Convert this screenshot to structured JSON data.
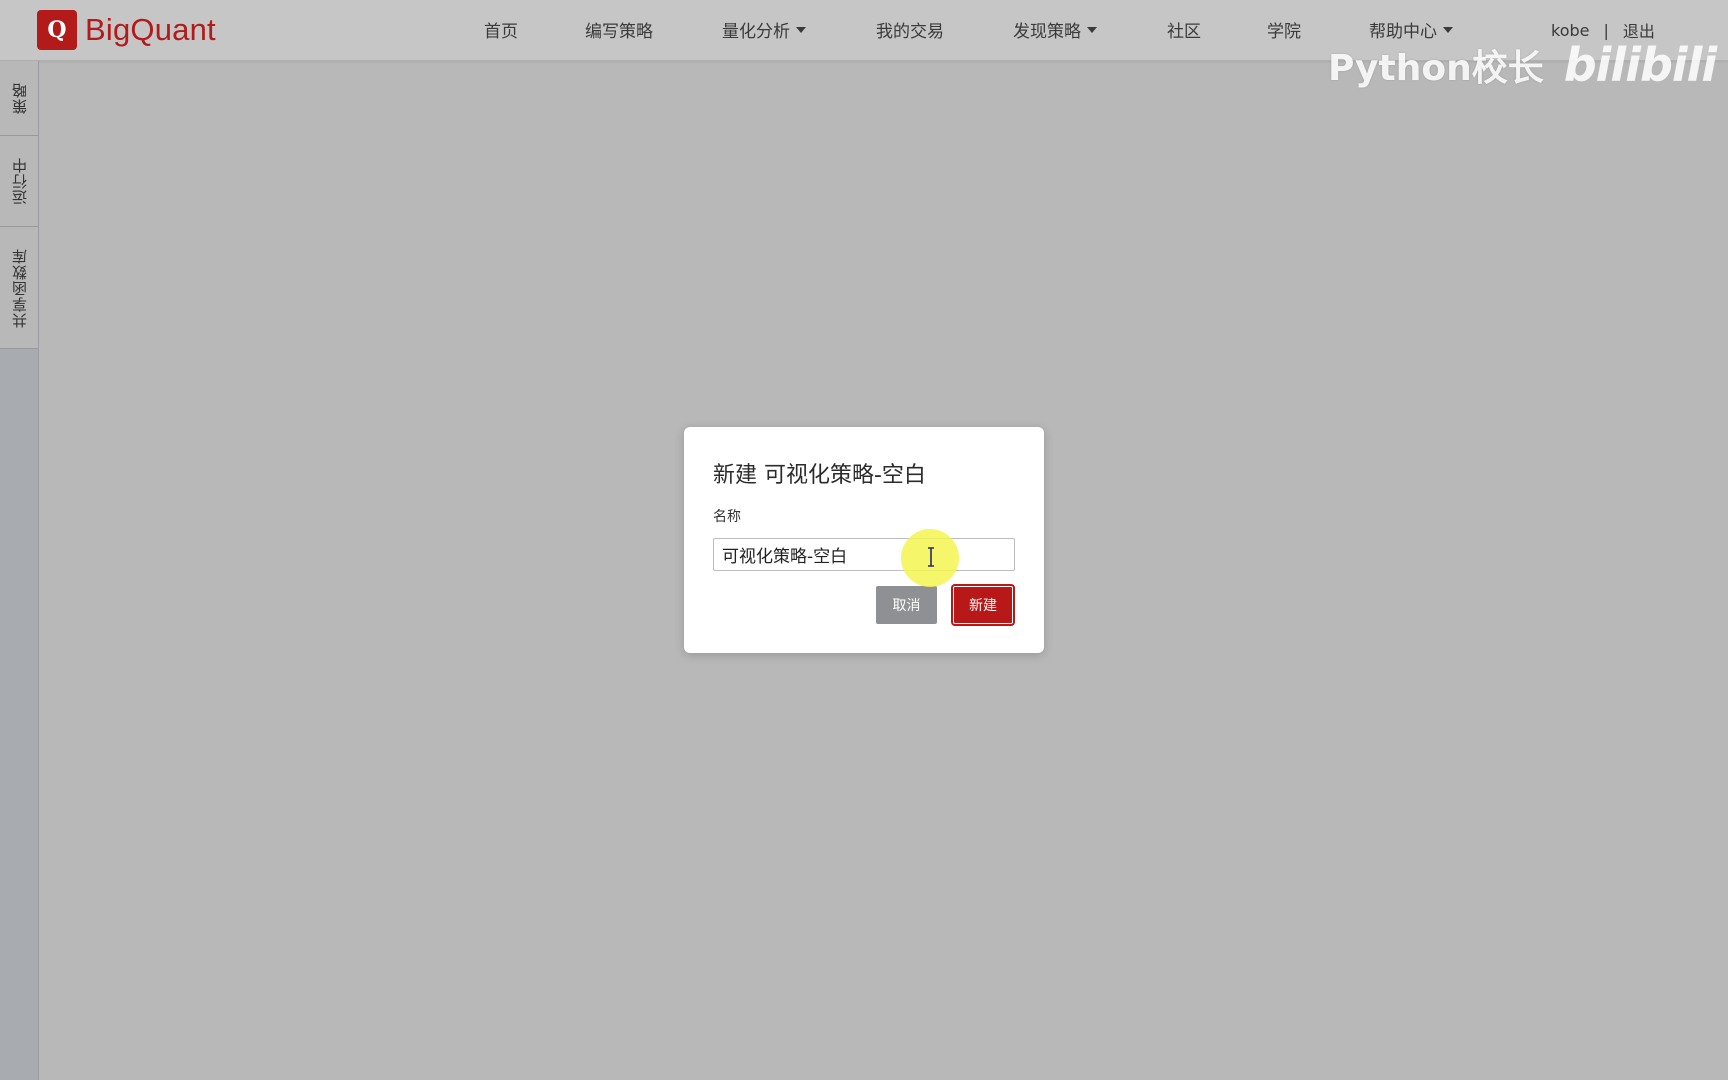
{
  "brand": {
    "logo_letter": "Q",
    "name": "BigQuant",
    "accent_color": "#b31a1a"
  },
  "nav": {
    "items": [
      {
        "label": "首页"
      },
      {
        "label": "编写策略"
      },
      {
        "label": "量化分析",
        "dropdown": true
      },
      {
        "label": "我的交易"
      },
      {
        "label": "发现策略",
        "dropdown": true
      },
      {
        "label": "社区"
      },
      {
        "label": "学院"
      },
      {
        "label": "帮助中心",
        "dropdown": true
      }
    ]
  },
  "user": {
    "name": "kobe",
    "separator": "|",
    "logout": "退出"
  },
  "watermark": {
    "text": "Python校长",
    "logo": "bilibili"
  },
  "sidebar": {
    "tabs": [
      {
        "label": "策略"
      },
      {
        "label": "运行中"
      },
      {
        "label": "共享函数库"
      }
    ]
  },
  "dialog": {
    "title": "新建 可视化策略-空白",
    "name_label": "名称",
    "name_value": "可视化策略-空白",
    "cancel_label": "取消",
    "create_label": "新建"
  },
  "icons": {
    "cursor": "text-cursor-icon",
    "caret": "chevron-down-icon"
  }
}
